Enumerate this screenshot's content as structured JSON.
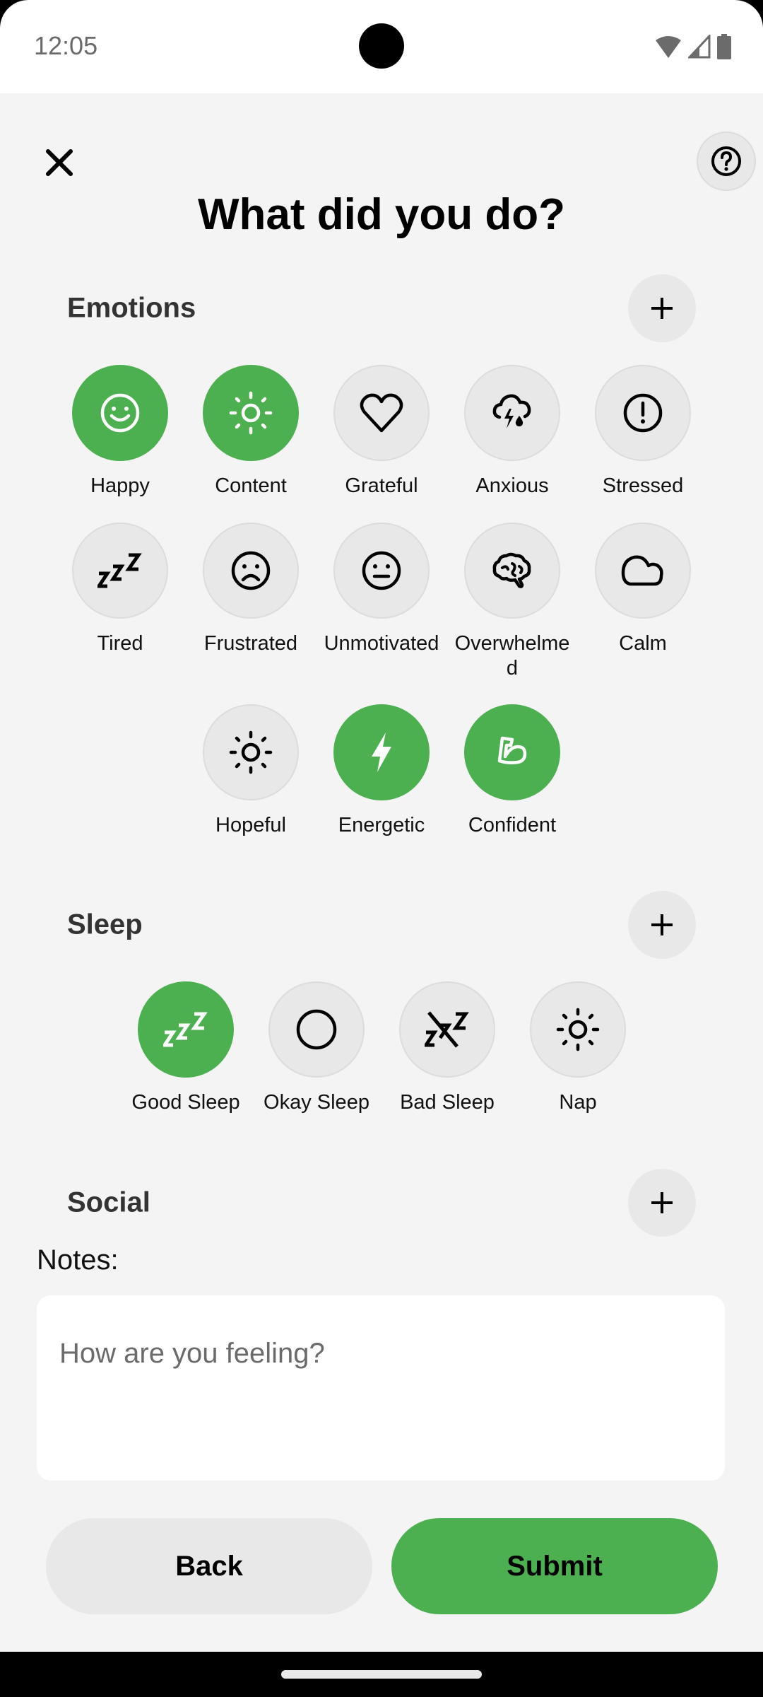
{
  "status_bar": {
    "time": "12:05",
    "icons": [
      "wifi-icon",
      "signal-icon",
      "battery-icon"
    ]
  },
  "header": {
    "close_icon": "close-icon",
    "help_icon": "help-circle-icon",
    "title": "What did you do?"
  },
  "theme": {
    "accent": "#4caf50",
    "chip_bg": "#e8e8e8",
    "background": "#f4f4f4"
  },
  "sections": {
    "emotions": {
      "title": "Emotions",
      "add_icon": "plus-icon",
      "items": [
        {
          "label": "Happy",
          "icon": "smile-icon",
          "selected": true
        },
        {
          "label": "Content",
          "icon": "sun-icon",
          "selected": true
        },
        {
          "label": "Grateful",
          "icon": "heart-icon",
          "selected": false
        },
        {
          "label": "Anxious",
          "icon": "storm-cloud-icon",
          "selected": false
        },
        {
          "label": "Stressed",
          "icon": "alert-circle-icon",
          "selected": false
        },
        {
          "label": "Tired",
          "icon": "zzz-icon",
          "selected": false
        },
        {
          "label": "Frustrated",
          "icon": "frown-icon",
          "selected": false
        },
        {
          "label": "Unmotivated",
          "icon": "neutral-face-icon",
          "selected": false
        },
        {
          "label": "Overwhelmed",
          "icon": "brain-icon",
          "selected": false
        },
        {
          "label": "Calm",
          "icon": "cloud-icon",
          "selected": false
        },
        {
          "label": "Hopeful",
          "icon": "sun-icon",
          "selected": false
        },
        {
          "label": "Energetic",
          "icon": "lightning-icon",
          "selected": true
        },
        {
          "label": "Confident",
          "icon": "flexed-arm-icon",
          "selected": true
        }
      ]
    },
    "sleep": {
      "title": "Sleep",
      "add_icon": "plus-icon",
      "items": [
        {
          "label": "Good Sleep",
          "icon": "zzz-icon",
          "selected": true
        },
        {
          "label": "Okay Sleep",
          "icon": "circle-icon",
          "selected": false
        },
        {
          "label": "Bad Sleep",
          "icon": "zzz-off-icon",
          "selected": false
        },
        {
          "label": "Nap",
          "icon": "sun-icon",
          "selected": false
        }
      ]
    },
    "social": {
      "title": "Social",
      "add_icon": "plus-icon"
    }
  },
  "notes": {
    "label": "Notes:",
    "placeholder": "How are you feeling?",
    "value": ""
  },
  "actions": {
    "back_label": "Back",
    "submit_label": "Submit"
  }
}
